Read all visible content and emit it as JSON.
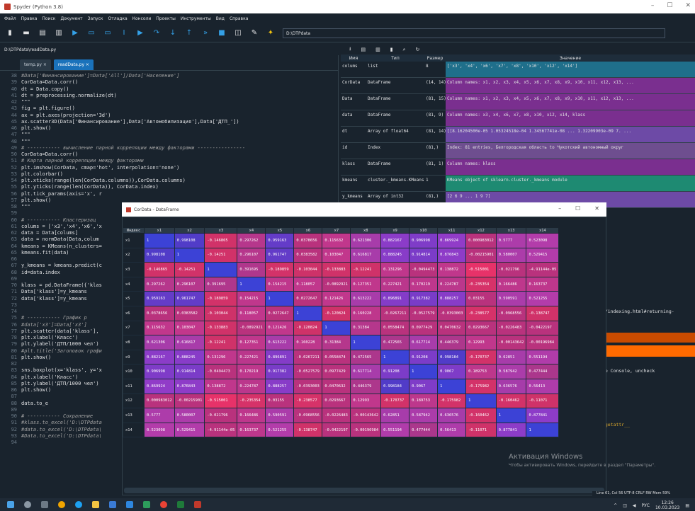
{
  "window": {
    "title": "Spyder (Python 3.8)"
  },
  "menu": [
    "Файл",
    "Правка",
    "Поиск",
    "Документ",
    "Запуск",
    "Отладка",
    "Консоли",
    "Проекты",
    "Инструменты",
    "Вид",
    "Справка"
  ],
  "toolbar": {
    "path": "D:\\DTPdata"
  },
  "editor": {
    "filepath": "D:\\DTPdata\\readData.py",
    "tabs": [
      "temp.py ×",
      "readData.py ×"
    ],
    "lines": [
      {
        "n": "38",
        "t": "#Data['Финансирование']=Data['All']/Data['Население']"
      },
      {
        "n": "39",
        "t": "CorData=Data.corr()"
      },
      {
        "n": "40",
        "t": "dt = Data.copy()"
      },
      {
        "n": "41",
        "t": "dt = preprocessing.normalize(dt)"
      },
      {
        "n": "42",
        "t": "\"\"\""
      },
      {
        "n": "43",
        "t": "fig = plt.figure()"
      },
      {
        "n": "44",
        "t": "ax = plt.axes(projection='3d')"
      },
      {
        "n": "45",
        "t": "ax.scatter3D(Data['Финансирование'],Data['Автомобилизация'],Data['ДТП_'])"
      },
      {
        "n": "46",
        "t": "plt.show()"
      },
      {
        "n": "47",
        "t": "\"\"\""
      },
      {
        "n": "48",
        "t": "\"\"\""
      },
      {
        "n": "49",
        "t": "# ----------- вычисление парной корреляции между факторами ----------------"
      },
      {
        "n": "50",
        "t": "CorData=Data.corr()"
      },
      {
        "n": "51",
        "t": "# Карта парной корреляции между факторами"
      },
      {
        "n": "52",
        "t": "plt.imshow(CorData, cmap='hot', interpolation='none')"
      },
      {
        "n": "53",
        "t": "plt.colorbar()"
      },
      {
        "n": "54",
        "t": "plt.xticks(range(len(CorData.columns)),CorData.columns)"
      },
      {
        "n": "55",
        "t": "plt.yticks(range(len(CorData)), CorData.index)"
      },
      {
        "n": "56",
        "t": "plt.tick_params(axis='x', r"
      },
      {
        "n": "57",
        "t": "plt.show()"
      },
      {
        "n": "58",
        "t": "\"\"\""
      },
      {
        "n": "59",
        "t": ""
      },
      {
        "n": "60",
        "t": "# ----------- Кластеризац"
      },
      {
        "n": "61",
        "t": "colums = ['x3','x4','x6','x"
      },
      {
        "n": "62",
        "t": "data = Data[colums]"
      },
      {
        "n": "63",
        "t": "data = normData(Data,colum"
      },
      {
        "n": "64",
        "t": "kmeans = KMeans(n_clusters="
      },
      {
        "n": "65",
        "t": "kmeans.fit(data)"
      },
      {
        "n": "66",
        "t": ""
      },
      {
        "n": "67",
        "t": "y_kmeans = kmeans.predict(c"
      },
      {
        "n": "68",
        "t": "id=data.index"
      },
      {
        "n": "69",
        "t": ""
      },
      {
        "n": "70",
        "t": "klass = pd.DataFrame({'klas"
      },
      {
        "n": "71",
        "t": "Data['klass']=y_kmeans"
      },
      {
        "n": "72",
        "t": "data['klass']=y_kmeans"
      },
      {
        "n": "73",
        "t": ""
      },
      {
        "n": "74",
        "t": ""
      },
      {
        "n": "75",
        "t": "# ----------- График р"
      },
      {
        "n": "76",
        "t": "#data['x3']=Data['x3']"
      },
      {
        "n": "77",
        "t": "plt.scatter(data['klass'],"
      },
      {
        "n": "78",
        "t": "plt.xlabel('Класс')"
      },
      {
        "n": "79",
        "t": "plt.ylabel('ДТП/1000 чел')"
      },
      {
        "n": "80",
        "t": "#plt.title('Заголовок графи"
      },
      {
        "n": "81",
        "t": "plt.show()"
      },
      {
        "n": "82",
        "t": ""
      },
      {
        "n": "83",
        "t": "sns.boxplot(x='klass', y='x"
      },
      {
        "n": "84",
        "t": "plt.xlabel('Класс')"
      },
      {
        "n": "85",
        "t": "plt.ylabel('ДТП/1000 чел')"
      },
      {
        "n": "86",
        "t": "plt.show()"
      },
      {
        "n": "87",
        "t": ""
      },
      {
        "n": "88",
        "t": "data.to_e"
      },
      {
        "n": "89",
        "t": ""
      },
      {
        "n": "90",
        "t": "# ----------- Сохранение"
      },
      {
        "n": "91",
        "t": "#klass.to_excel('D:\\DTPdata"
      },
      {
        "n": "92",
        "t": "#data.to_excel('D:\\DTPdata\\"
      },
      {
        "n": "93",
        "t": "#Data.to_excel('D:\\DTPdata\\"
      },
      {
        "n": "94",
        "t": ""
      }
    ]
  },
  "variables": {
    "headers": [
      "Имя",
      "Тип",
      "Размер",
      "Значение"
    ],
    "rows": [
      {
        "name": "colums",
        "type": "list",
        "size": "8",
        "value": "['x3', 'x4', 'x6', 'x7', 'x8', 'x10', 'x12', 'x14']",
        "color": "#1f6f8b"
      },
      {
        "name": "CorData",
        "type": "DataFrame",
        "size": "(14, 14)",
        "value": "Column names: x1, x2, x3, x4, x5, x6, x7, x8, x9, x10, x11, x12, x13, ...",
        "color": "#7a2f8f"
      },
      {
        "name": "Data",
        "type": "DataFrame",
        "size": "(81, 15)",
        "value": "Column names: x1, x2, x3, x4, x5, x6, x7, x8, x9, x10, x11, x12, x13, ...",
        "color": "#7a2f8f"
      },
      {
        "name": "data",
        "type": "DataFrame",
        "size": "(81, 9)",
        "value": "Column names: x3, x4, x6, x7, x8, x10, x12, x14, klass",
        "color": "#7a2f8f"
      },
      {
        "name": "dt",
        "type": "Array of float64",
        "size": "(81, 14)",
        "value": "[[8.16204500e-05 1.05324518e-04 1.34567741e-08 ... 1.32209903e-09  7. ...",
        "color": "#6d4aa6"
      },
      {
        "name": "id",
        "type": "Index",
        "size": "(81,)",
        "value": "Index: 81 entries, Белгородская область to Чукотский автономный округ",
        "color": "#6e4e8f"
      },
      {
        "name": "klass",
        "type": "DataFrame",
        "size": "(81, 1)",
        "value": "Column names: klass",
        "color": "#7a2f8f"
      },
      {
        "name": "kmeans",
        "type": "cluster._kmeans.KMeans",
        "size": "1",
        "value": "KMeans object of sklearn.cluster._kmeans module",
        "color": "#1e8a72"
      },
      {
        "name": "y_kmeans",
        "type": "Array of int32",
        "size": "(81,)",
        "value": "[2 6 9 ... 1 9 7]",
        "color": "#6d4aa6"
      }
    ]
  },
  "console_fragments": {
    "line1": "de/indexing.html#returning-",
    "line2": "the Console, uncheck",
    "line3": "__getattr__"
  },
  "dataframe": {
    "title": "CorData - DataFrame",
    "index_header": "Индекс",
    "columns": [
      "x1",
      "x2",
      "x3",
      "x4",
      "x5",
      "x6",
      "x7",
      "x8",
      "x9",
      "x10",
      "x11",
      "x12",
      "x13",
      "x14"
    ],
    "rows": [
      {
        "idx": "x1",
        "v": [
          "1",
          "0.998108",
          "-0.146865",
          "0.297262",
          "0.959163",
          "0.0378656",
          "0.115632",
          "0.621306",
          "0.882167",
          "0.906998",
          "0.869924",
          "0.000983012",
          "0.5777",
          "0.523098"
        ]
      },
      {
        "idx": "x2",
        "v": [
          "0.998108",
          "1",
          "-0.14251",
          "0.296107",
          "0.961747",
          "0.0383582",
          "0.103047",
          "0.616817",
          "0.888245",
          "0.914814",
          "0.876843",
          "-0.00215901",
          "0.580007",
          "0.529415"
        ]
      },
      {
        "idx": "x3",
        "v": [
          "-0.146865",
          "-0.14251",
          "1",
          "0.391695",
          "-0.189859",
          "-0.103044",
          "-0.133883",
          "-0.12241",
          "0.131296",
          "-0.0494473",
          "0.138872",
          "-0.515001",
          "-0.021796",
          "-4.91144e-05"
        ]
      },
      {
        "idx": "x4",
        "v": [
          "0.297262",
          "0.296107",
          "0.391695",
          "1",
          "0.154215",
          "0.118057",
          "-0.0892921",
          "0.127351",
          "0.227421",
          "0.170219",
          "0.224787",
          "-0.235354",
          "0.166486",
          "0.163737"
        ]
      },
      {
        "idx": "x5",
        "v": [
          "0.959163",
          "0.961747",
          "-0.189859",
          "0.154215",
          "1",
          "0.0272647",
          "0.121426",
          "0.613222",
          "0.896891",
          "0.917382",
          "0.888257",
          "0.03155",
          "0.590591",
          "0.521255"
        ]
      },
      {
        "idx": "x6",
        "v": [
          "0.0378656",
          "0.0383582",
          "-0.103044",
          "0.118057",
          "0.0272647",
          "1",
          "-0.120824",
          "0.160228",
          "-0.0267211",
          "-0.0527579",
          "-0.0393003",
          "-0.238577",
          "-0.0968556",
          "-0.138747"
        ]
      },
      {
        "idx": "x7",
        "v": [
          "0.115632",
          "0.103047",
          "-0.133883",
          "-0.0892921",
          "0.121426",
          "-0.120824",
          "1",
          "0.31384",
          "0.0558474",
          "0.0977429",
          "0.0470632",
          "0.0293667",
          "-0.0226483",
          "-0.0422197"
        ]
      },
      {
        "idx": "x8",
        "v": [
          "0.621306",
          "0.616817",
          "-0.12241",
          "0.127351",
          "0.613222",
          "0.160228",
          "0.31384",
          "1",
          "0.472565",
          "0.617714",
          "0.446379",
          "0.12993",
          "-0.00143642",
          "-0.00196984"
        ]
      },
      {
        "idx": "x9",
        "v": [
          "0.882167",
          "0.888245",
          "0.131296",
          "0.227421",
          "0.896891",
          "-0.0267211",
          "0.0558474",
          "0.472565",
          "1",
          "0.91208",
          "0.998184",
          "-0.170737",
          "0.62851",
          "0.551194"
        ]
      },
      {
        "idx": "x10",
        "v": [
          "0.906998",
          "0.914814",
          "-0.0494473",
          "0.170219",
          "0.917382",
          "-0.0527579",
          "0.0977429",
          "0.617714",
          "0.91208",
          "1",
          "0.9067",
          "0.189753",
          "0.587942",
          "0.477444"
        ]
      },
      {
        "idx": "x11",
        "v": [
          "0.869924",
          "0.876843",
          "0.138872",
          "0.224787",
          "0.888257",
          "-0.0393003",
          "0.0470632",
          "0.446379",
          "0.998184",
          "0.9067",
          "1",
          "-0.175982",
          "0.636576",
          "0.56413"
        ]
      },
      {
        "idx": "x12",
        "v": [
          "0.000983012",
          "-0.00215901",
          "-0.515001",
          "-0.235354",
          "0.03155",
          "-0.238577",
          "0.0293667",
          "0.12993",
          "-0.170737",
          "0.189753",
          "-0.175982",
          "1",
          "-0.160462",
          "-0.11071"
        ]
      },
      {
        "idx": "x13",
        "v": [
          "0.5777",
          "0.580007",
          "-0.021796",
          "0.166486",
          "0.590591",
          "-0.0968556",
          "-0.0226483",
          "-0.00143642",
          "0.62851",
          "0.587942",
          "0.636576",
          "-0.160462",
          "1",
          "0.877841"
        ]
      },
      {
        "idx": "x14",
        "v": [
          "0.523098",
          "0.529415",
          "-4.91144e-05",
          "0.163737",
          "0.521255",
          "-0.138747",
          "-0.0422197",
          "-0.00196984",
          "0.551194",
          "0.477444",
          "0.56413",
          "-0.11071",
          "0.877841",
          "1"
        ]
      }
    ]
  },
  "watermark": {
    "title": "Активация Windows",
    "sub": "Чтобы активировать Windows, перейдите в раздел \"Параметры\"."
  },
  "status": "Line 61, Col 56  UTF-8  CRLF  RW  Mem 59%",
  "taskbar": {
    "lang": "РУС",
    "time": "12:26",
    "date": "10.03.2023"
  }
}
